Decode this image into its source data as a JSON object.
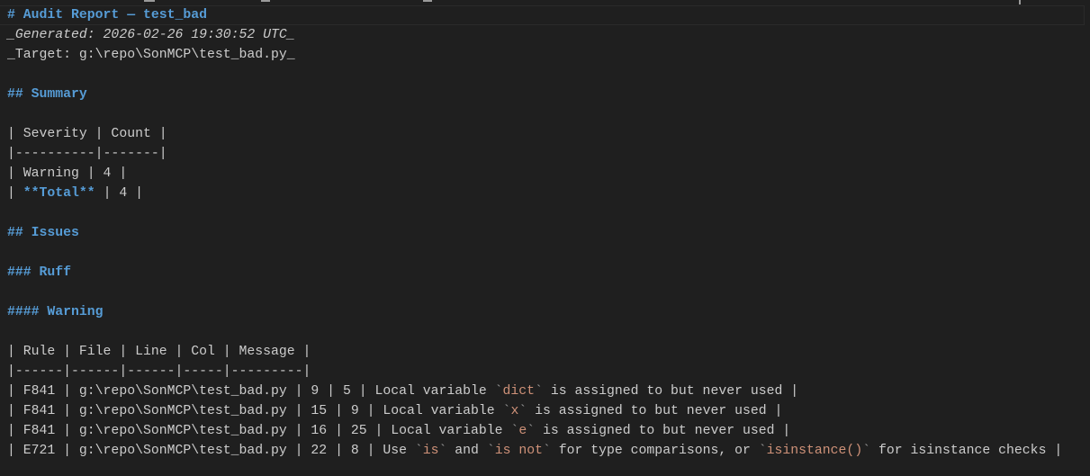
{
  "doc": {
    "title": "# Audit Report — test_bad",
    "generated": "_Generated: 2026-02-26 19:30:52 UTC_",
    "target": "_Target: g:\\repo\\SonMCP\\test_bad.py_",
    "summary_heading": "## Summary",
    "summary_table": {
      "header": "| Severity | Count |",
      "separator": "|----------|-------|",
      "row_warning": "| Warning | 4 |",
      "total_prefix": "| ",
      "total_label": "**Total**",
      "total_suffix": " | 4 |"
    },
    "issues_heading": "## Issues",
    "ruff_heading": "### Ruff",
    "warning_heading": "#### Warning",
    "issues_table": {
      "header": "| Rule | File | Line | Col | Message |",
      "separator": "|------|------|------|-----|---------|",
      "rows": [
        {
          "prefix": "| F841 | g:\\repo\\SonMCP\\test_bad.py | 9 | 5 | Local variable ",
          "code1": "dict",
          "mid1": " is assigned to but never used |"
        },
        {
          "prefix": "| F841 | g:\\repo\\SonMCP\\test_bad.py | 15 | 9 | Local variable ",
          "code1": "x",
          "mid1": " is assigned to but never used |"
        },
        {
          "prefix": "| F841 | g:\\repo\\SonMCP\\test_bad.py | 16 | 25 | Local variable ",
          "code1": "e",
          "mid1": " is assigned to but never used |"
        },
        {
          "prefix": "| E721 | g:\\repo\\SonMCP\\test_bad.py | 22 | 8 | Use ",
          "code1": "is",
          "mid1": " and ",
          "code2": "is not",
          "mid2": " for type comparisons, or ",
          "code3": "isinstance()",
          "mid3": " for isinstance checks |"
        }
      ]
    },
    "backtick": "`"
  }
}
